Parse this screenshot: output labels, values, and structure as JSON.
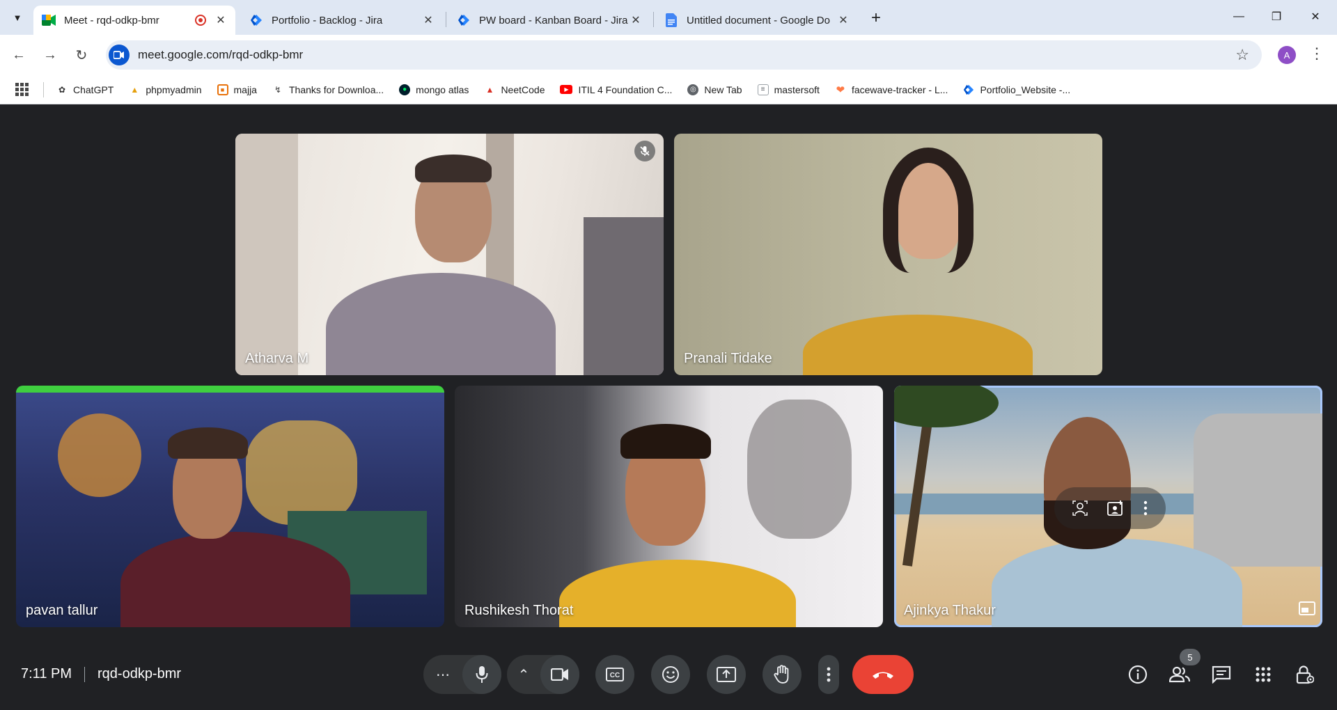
{
  "browser": {
    "tabs": [
      {
        "title": "Meet - rqd-odkp-bmr",
        "active": true,
        "recording": true
      },
      {
        "title": "Portfolio - Backlog - Jira",
        "active": false
      },
      {
        "title": "PW board - Kanban Board - Jira",
        "active": false
      },
      {
        "title": "Untitled document - Google Do",
        "active": false
      }
    ],
    "url": "meet.google.com/rqd-odkp-bmr",
    "profile_initial": "A",
    "bookmarks": [
      {
        "label": "ChatGPT",
        "icon": "chatgpt-icon"
      },
      {
        "label": "phpmyadmin",
        "icon": "phpmyadmin-icon"
      },
      {
        "label": "majja",
        "icon": "majja-icon"
      },
      {
        "label": "Thanks for Downloa...",
        "icon": "download-icon"
      },
      {
        "label": "mongo atlas",
        "icon": "mongodb-icon"
      },
      {
        "label": "NeetCode",
        "icon": "neetcode-icon"
      },
      {
        "label": "ITIL 4 Foundation C...",
        "icon": "youtube-icon"
      },
      {
        "label": "New Tab",
        "icon": "globe-icon"
      },
      {
        "label": "mastersoft",
        "icon": "document-icon"
      },
      {
        "label": "facewave-tracker - L...",
        "icon": "heart-icon"
      },
      {
        "label": "Portfolio_Website -...",
        "icon": "jira-icon"
      }
    ]
  },
  "meet": {
    "participants": [
      {
        "name": "Atharva M",
        "muted": true
      },
      {
        "name": "Pranali Tidake",
        "muted": false
      },
      {
        "name": "pavan tallur",
        "muted": false
      },
      {
        "name": "Rushikesh Thorat",
        "muted": false
      },
      {
        "name": "Ajinkya Thakur",
        "muted": false,
        "pinned": true
      }
    ],
    "time": "7:11 PM",
    "meeting_code": "rqd-odkp-bmr",
    "people_count": "5",
    "colors": {
      "background": "#202124",
      "hangup": "#ea4335",
      "control": "#3c4043",
      "accent": "#a8c7fa"
    }
  }
}
